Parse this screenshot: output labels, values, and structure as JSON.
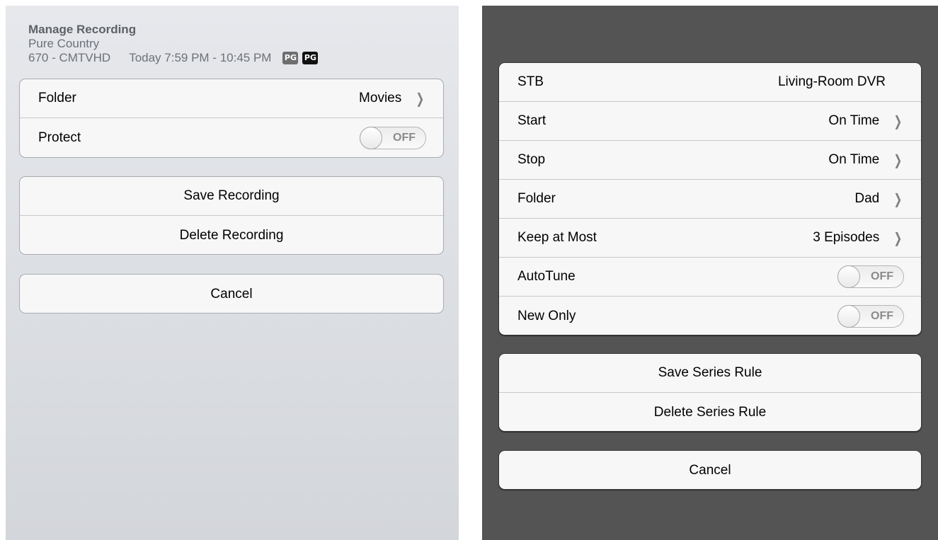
{
  "left": {
    "header": {
      "title": "Manage Recording",
      "show": "Pure Country",
      "channel": "670 - CMTVHD",
      "time": "Today 7:59 PM - 10:45 PM",
      "badge_tv": "PG",
      "badge_pg": "PG"
    },
    "settings": {
      "folder_label": "Folder",
      "folder_value": "Movies",
      "protect_label": "Protect",
      "protect_state": "OFF"
    },
    "actions": {
      "save": "Save Recording",
      "delete": "Delete Recording"
    },
    "cancel": "Cancel"
  },
  "right": {
    "settings": {
      "stb_label": "STB",
      "stb_value": "Living-Room DVR",
      "start_label": "Start",
      "start_value": "On Time",
      "stop_label": "Stop",
      "stop_value": "On Time",
      "folder_label": "Folder",
      "folder_value": "Dad",
      "keep_label": "Keep at Most",
      "keep_value": "3 Episodes",
      "autotune_label": "AutoTune",
      "autotune_state": "OFF",
      "newonly_label": "New Only",
      "newonly_state": "OFF"
    },
    "actions": {
      "save": "Save Series Rule",
      "delete": "Delete Series Rule"
    },
    "cancel": "Cancel"
  },
  "icons": {
    "chevron": "chevron-right-icon",
    "tv_rating": "tv-pg-rating-icon",
    "pg_rating": "pg-rating-icon"
  }
}
